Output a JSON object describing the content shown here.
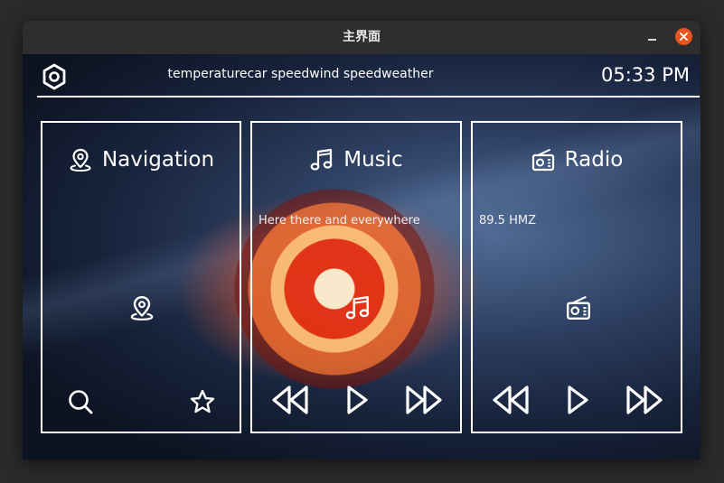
{
  "window": {
    "title": "主界面"
  },
  "status_bar": {
    "text": "temperaturecar speedwind speedweather",
    "time": "05:33 PM"
  },
  "panels": {
    "navigation": {
      "title": "Navigation",
      "icon": "location-pin-icon"
    },
    "music": {
      "title": "Music",
      "track": "Here there and everywhere",
      "icon": "music-note-icon"
    },
    "radio": {
      "title": "Radio",
      "frequency": "89.5 HMZ",
      "icon": "radio-icon"
    }
  },
  "colors": {
    "accent": "#ffffff",
    "close_button": "#e95420",
    "titlebar": "#2e2e2e"
  }
}
